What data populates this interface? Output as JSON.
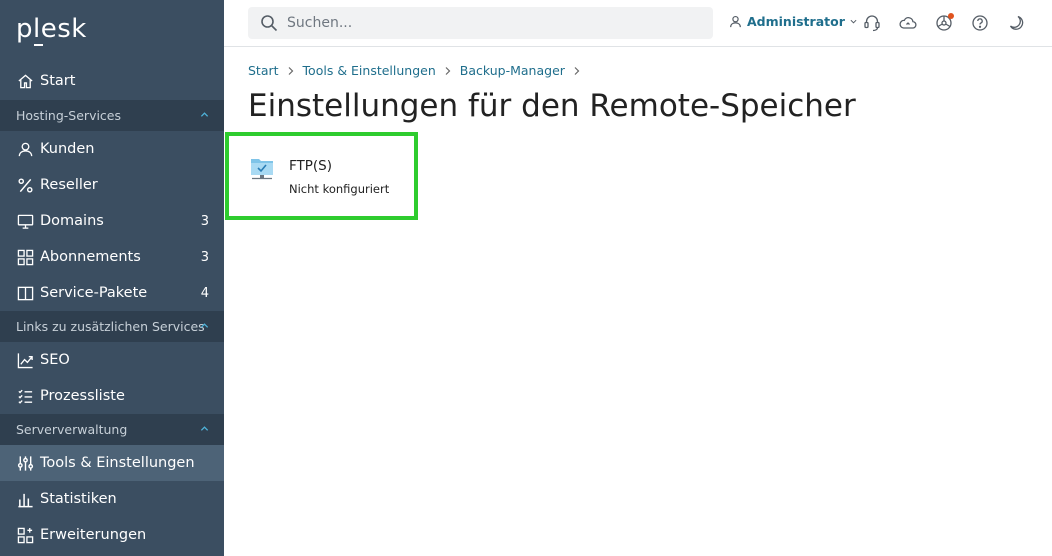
{
  "app": {
    "logo": "plesk"
  },
  "sidebar": {
    "start": {
      "label": "Start",
      "icon": "home-icon"
    },
    "groups": [
      {
        "label": "Hosting-Services",
        "items": [
          {
            "label": "Kunden",
            "icon": "user-icon",
            "count": ""
          },
          {
            "label": "Reseller",
            "icon": "percent-icon",
            "count": ""
          },
          {
            "label": "Domains",
            "icon": "monitor-icon",
            "count": "3"
          },
          {
            "label": "Abonnements",
            "icon": "grid-icon",
            "count": "3"
          },
          {
            "label": "Service-Pakete",
            "icon": "book-icon",
            "count": "4"
          }
        ]
      },
      {
        "label": "Links zu zusätzlichen Services",
        "items": [
          {
            "label": "SEO",
            "icon": "chart-line-icon"
          },
          {
            "label": "Prozessliste",
            "icon": "list-icon"
          }
        ]
      },
      {
        "label": "Serververwaltung",
        "items": [
          {
            "label": "Tools & Einstellungen",
            "icon": "sliders-icon",
            "active": true
          },
          {
            "label": "Statistiken",
            "icon": "bar-chart-icon"
          },
          {
            "label": "Erweiterungen",
            "icon": "extensions-icon"
          }
        ]
      }
    ]
  },
  "topbar": {
    "search_placeholder": "Suchen...",
    "user": "Administrator",
    "icons": [
      "support-icon",
      "cloud-icon",
      "advisor-icon",
      "help-icon",
      "dark-mode-icon"
    ],
    "accent": "#1f6e8c",
    "notification_color": "#e0531e"
  },
  "breadcrumb": [
    "Start",
    "Tools & Einstellungen",
    "Backup-Manager"
  ],
  "page": {
    "title": "Einstellungen für den Remote-Speicher",
    "card": {
      "title": "FTP(S)",
      "status": "Nicht konfiguriert",
      "icon": "ftp-folder-icon",
      "highlight_color": "#2ecc2e"
    }
  }
}
